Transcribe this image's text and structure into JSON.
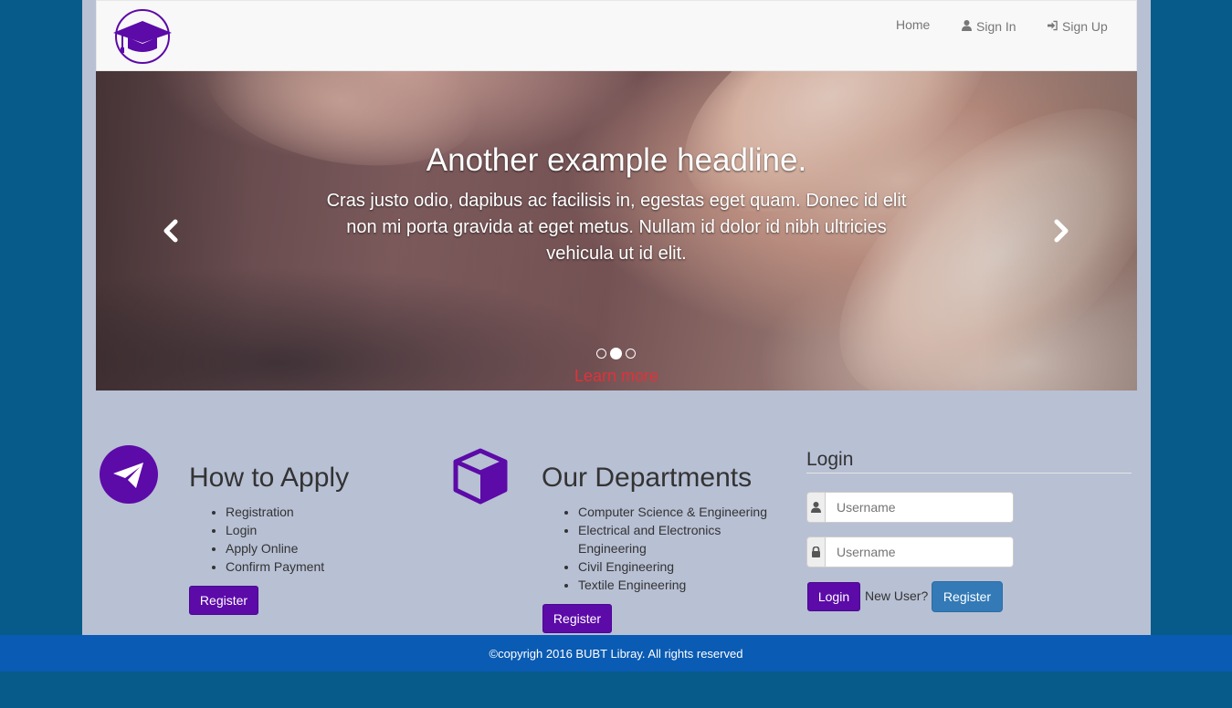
{
  "nav": {
    "home": "Home",
    "sign_in": "Sign In",
    "sign_up": "Sign Up",
    "logo_icon": "graduation-cap-icon"
  },
  "carousel": {
    "headline": "Another example headline.",
    "text": "Cras justo odio, dapibus ac facilisis in, egestas eget quam. Donec id elit non mi porta gravida at eget metus. Nullam id dolor id nibh ultricies vehicula ut id elit.",
    "cta": "Learn more",
    "slide_count": 3,
    "active_slide": 2
  },
  "apply": {
    "icon": "paper-plane-icon",
    "title": "How to Apply",
    "items": [
      "Registration",
      "Login",
      "Apply Online",
      "Confirm Payment"
    ],
    "button": "Register"
  },
  "departments": {
    "icon": "cube-icon",
    "title": "Our Departments",
    "items": [
      "Computer Science & Engineering",
      "Electrical and Electronics Engineering",
      "Civil Engineering",
      "Textile Engineering"
    ],
    "button": "Register"
  },
  "login": {
    "title": "Login",
    "username_placeholder": "Username",
    "password_placeholder": "Username",
    "login_button": "Login",
    "new_user": "New User?",
    "register_button": "Register"
  },
  "footer": {
    "text": "©copyrigh 2016 BUBT Libray. All rights reserved"
  },
  "colors": {
    "brand_purple": "#5c0aa8",
    "page_bg": "#065b8a",
    "content_bg": "#b8c0d4",
    "footer_bg": "#0a5bb3",
    "cta_red": "#e0323a",
    "register_blue": "#337ab7"
  }
}
